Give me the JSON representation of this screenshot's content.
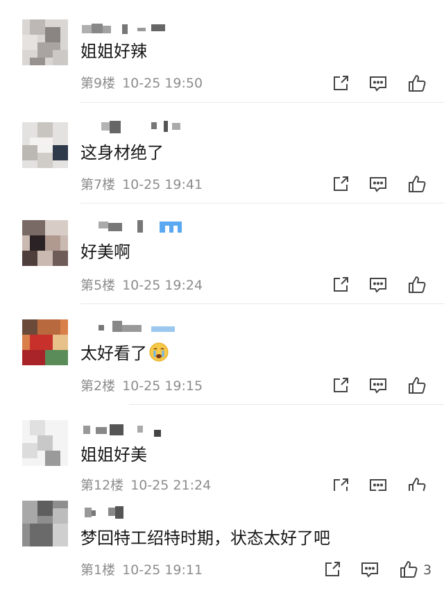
{
  "colors": {
    "icon": "#444444",
    "meta_text": "#8c8c8c",
    "divider": "#e9e9e9",
    "badge": "#5aa8f0"
  },
  "comments": [
    {
      "text": "姐姐好辣",
      "floor": "第9楼",
      "time": "10-25 19:50"
    },
    {
      "text": "这身材绝了",
      "floor": "第7楼",
      "time": "10-25 19:41"
    },
    {
      "text": "好美啊",
      "floor": "第5楼",
      "time": "10-25 19:24"
    },
    {
      "text": "太好看了",
      "emoji": "crying-face-emoji",
      "floor": "第2楼",
      "time": "10-25 19:15"
    },
    {
      "text": "姐姐好美",
      "floor": "第12楼",
      "time": "10-25 21:24"
    },
    {
      "text": "梦回特工绍特时期，状态太好了吧",
      "floor": "第1楼",
      "time": "10-25 19:11",
      "likes": "3"
    }
  ],
  "icons": {
    "share": "share-icon",
    "reply": "comment-icon",
    "like": "thumbs-up-icon"
  }
}
